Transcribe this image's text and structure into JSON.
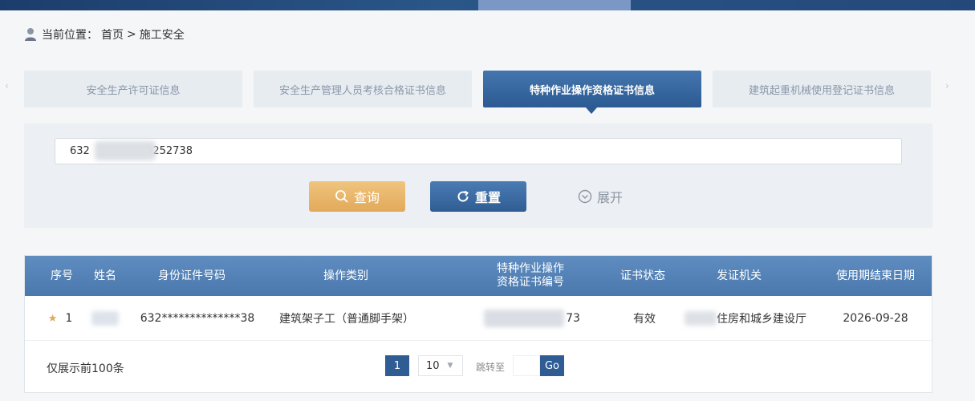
{
  "breadcrumb": {
    "prefix": "当前位置：",
    "home": "首页",
    "separator": ">",
    "current": "施工安全"
  },
  "tabs": [
    {
      "label": "安全生产许可证信息",
      "active": false
    },
    {
      "label": "安全生产管理人员考核合格证书信息",
      "active": false
    },
    {
      "label": "特种作业操作资格证书信息",
      "active": true
    },
    {
      "label": "建筑起重机械使用登记证书信息",
      "active": false
    }
  ],
  "tab_nav": {
    "prev_icon": "chevron-left-icon",
    "next_icon": "chevron-right-icon"
  },
  "search": {
    "value": "632                 0252738",
    "visible_prefix": "632",
    "visible_suffix": "0252738"
  },
  "buttons": {
    "query": "查询",
    "reset": "重置",
    "expand": "展开"
  },
  "table": {
    "headers": [
      "序号",
      "姓名",
      "身份证件号码",
      "操作类别",
      "特种作业操作\n资格证书编号",
      "证书状态",
      "发证机关",
      "使用期结束日期"
    ],
    "header_line1": "特种作业操作",
    "header_line2": "资格证书编号",
    "rows": [
      {
        "index": "1",
        "name": "",
        "id_number": "632**************38",
        "category": "建筑架子工（普通脚手架）",
        "cert_no_suffix": "73",
        "status": "有效",
        "issuer_suffix": "住房和城乡建设厅",
        "end_date": "2026-09-28"
      }
    ]
  },
  "footer": {
    "note": "仅展示前100条",
    "current_page": "1",
    "page_size": "10",
    "jump_label": "跳转至",
    "go": "Go"
  },
  "colors": {
    "primary": "#2f5d93",
    "accent": "#e2a95a",
    "header_bg": "#4a78ad"
  }
}
